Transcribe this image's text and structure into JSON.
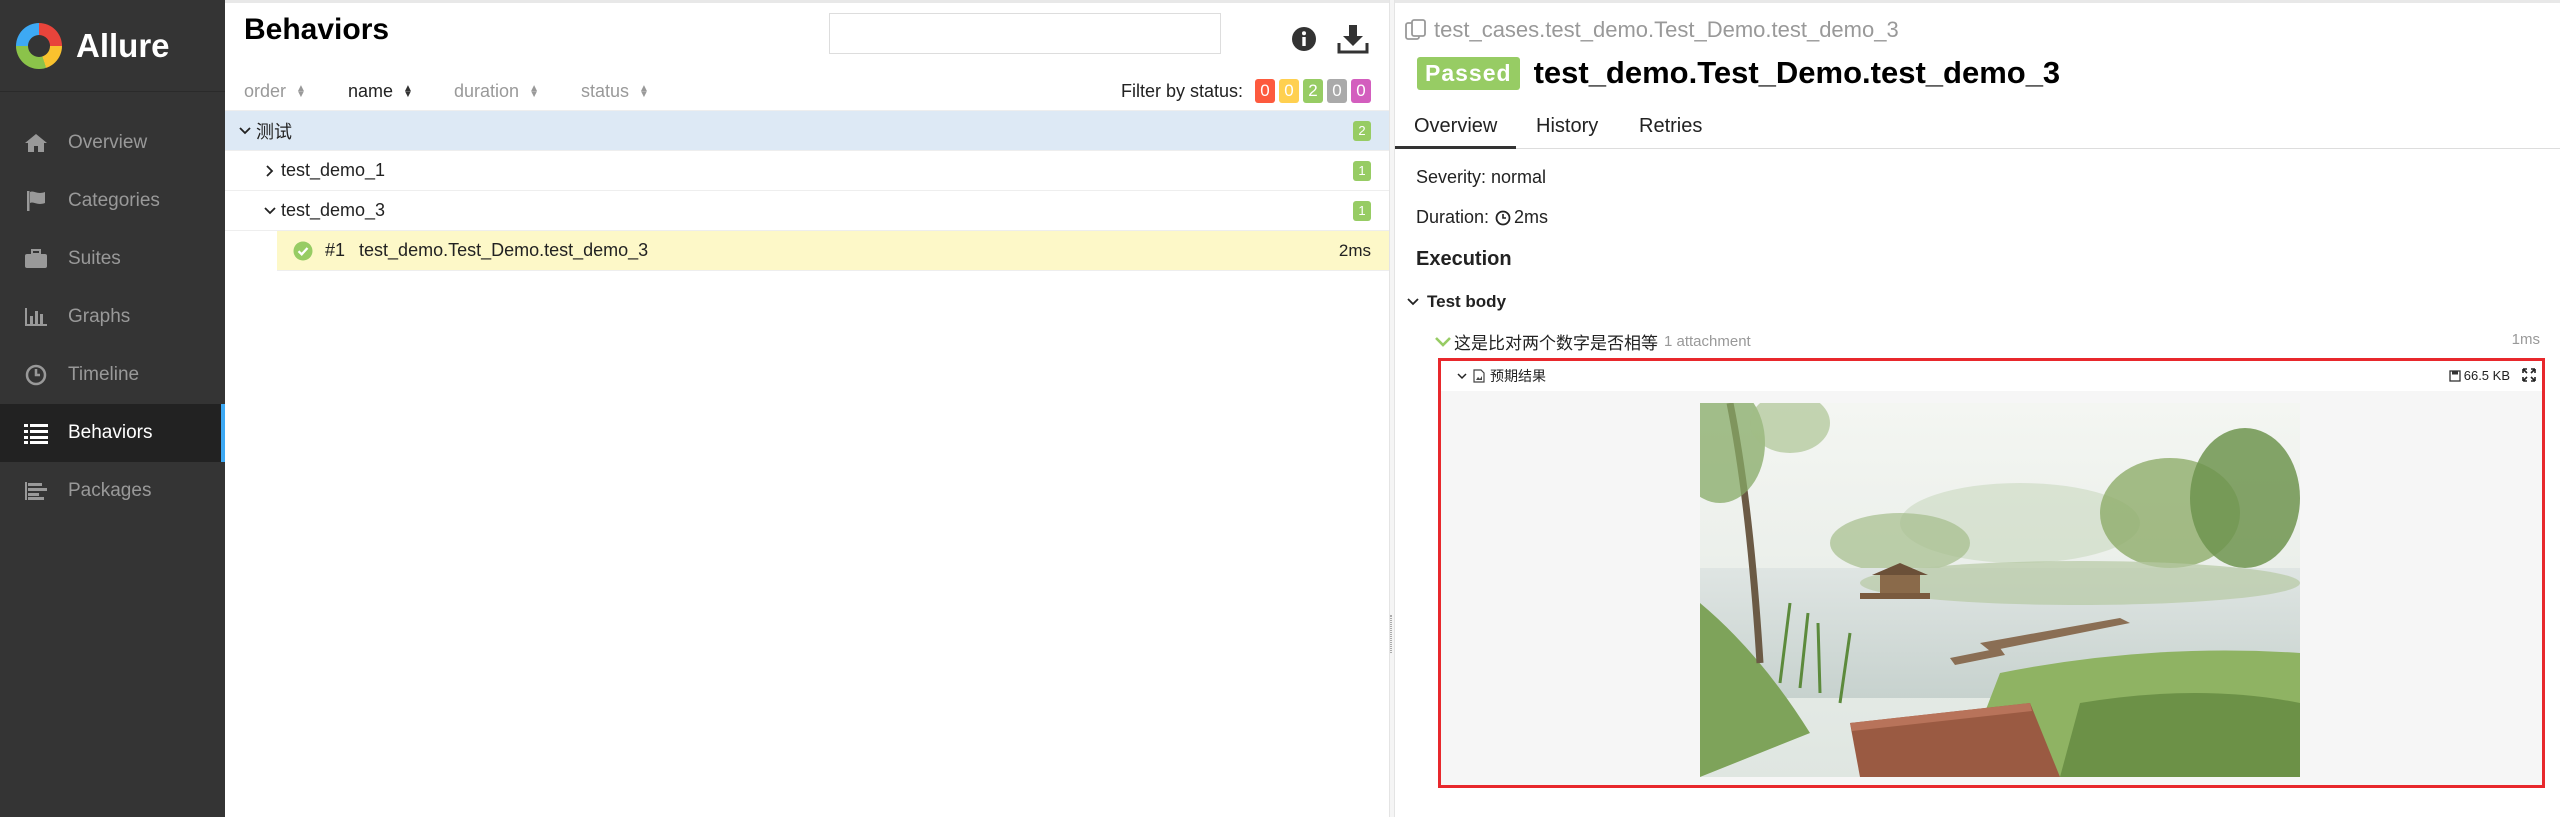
{
  "sidebar": {
    "brand": "Allure",
    "items": [
      {
        "label": "Overview",
        "icon": "home-icon"
      },
      {
        "label": "Categories",
        "icon": "flag-icon"
      },
      {
        "label": "Suites",
        "icon": "briefcase-icon"
      },
      {
        "label": "Graphs",
        "icon": "bar-chart-icon"
      },
      {
        "label": "Timeline",
        "icon": "clock-icon"
      },
      {
        "label": "Behaviors",
        "icon": "list-icon",
        "active": true
      },
      {
        "label": "Packages",
        "icon": "align-left-icon"
      }
    ]
  },
  "behaviors": {
    "title": "Behaviors",
    "search_value": "",
    "sort": {
      "order": "order",
      "name": "name",
      "duration": "duration",
      "status": "status"
    },
    "filter": {
      "label": "Filter by status:",
      "counts": [
        {
          "value": "0",
          "color": "#fd5a3e"
        },
        {
          "value": "0",
          "color": "#ffd050"
        },
        {
          "value": "2",
          "color": "#97cc64"
        },
        {
          "value": "0",
          "color": "#aaaaaa"
        },
        {
          "value": "0",
          "color": "#d35ebe"
        }
      ]
    },
    "tree": {
      "group": {
        "label": "测试",
        "count": "2"
      },
      "children": [
        {
          "label": "test_demo_1",
          "count": "1"
        },
        {
          "label": "test_demo_3",
          "count": "1"
        }
      ],
      "leaf": {
        "index": "#1",
        "name": "test_demo.Test_Demo.test_demo_3",
        "duration": "2ms"
      }
    }
  },
  "detail": {
    "path": "test_cases.test_demo.Test_Demo.test_demo_3",
    "status": "Passed",
    "name": "test_demo.Test_Demo.test_demo_3",
    "tabs": [
      "Overview",
      "History",
      "Retries"
    ],
    "severity": "Severity: normal",
    "duration_label": "Duration:",
    "duration_value": "2ms",
    "execution": "Execution",
    "test_body": "Test body",
    "step": {
      "label": "这是比对两个数字是否相等",
      "attachments": "1 attachment",
      "duration": "1ms"
    },
    "attachment": {
      "name": "预期结果",
      "size": "66.5 KB"
    },
    "colors": {
      "passed": "#97cc64",
      "highlight_border": "#e8282c",
      "active_nav": "#3da9f4"
    }
  }
}
